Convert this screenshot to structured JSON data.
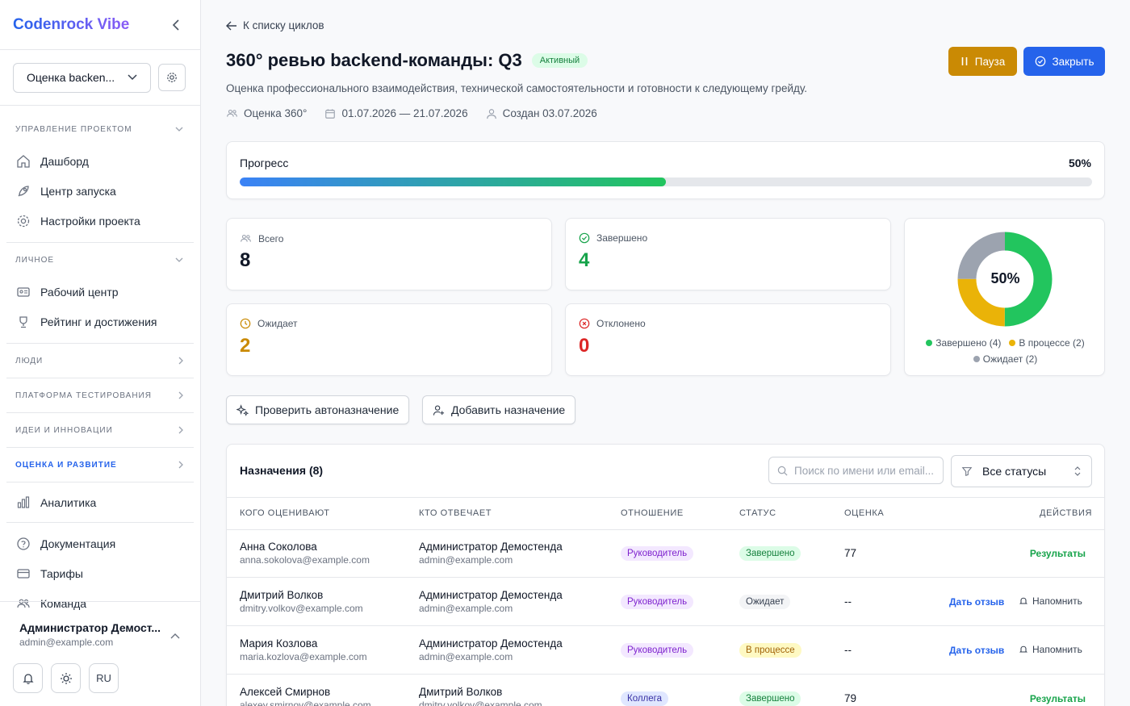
{
  "brand": "Codenrock Vibe",
  "project_select": "Оценка backen...",
  "sidebar": {
    "section_project": "Управление проектом",
    "project_items": [
      "Дашборд",
      "Центр запуска",
      "Настройки проекта"
    ],
    "section_personal": "Личное",
    "personal_items": [
      "Рабочий центр",
      "Рейтинг и достижения"
    ],
    "section_people": "Люди",
    "section_testing": "Платформа тестирования",
    "section_ideas": "Идеи и инновации",
    "section_eval": "Оценка и развитие",
    "analytics": "Аналитика",
    "bottom_items": [
      "Документация",
      "Тарифы",
      "Команда"
    ]
  },
  "user": {
    "name": "Администратор Демост...",
    "email": "admin@example.com",
    "lang": "RU"
  },
  "header": {
    "back": "К списку циклов",
    "title": "360° ревью backend-команды: Q3",
    "status": "Активный",
    "subtitle": "Оценка профессионального взаимодействия, технической самостоятельности и готовности к следующему грейду.",
    "meta_type": "Оценка 360°",
    "meta_dates": "01.07.2026 — 21.07.2026",
    "meta_created": "Создан 03.07.2026",
    "pause": "Пауза",
    "close": "Закрыть"
  },
  "progress": {
    "label": "Прогресс",
    "percent_text": "50%",
    "value": 0.5
  },
  "stats": {
    "total_label": "Всего",
    "total": "8",
    "done_label": "Завершено",
    "done": "4",
    "pending_label": "Ожидает",
    "pending": "2",
    "rejected_label": "Отклонено",
    "rejected": "0"
  },
  "donut": {
    "center": "50%",
    "legend": [
      "Завершено (4)",
      "В процессе (2)",
      "Ожидает (2)"
    ],
    "values": [
      4,
      2,
      2
    ],
    "colors": [
      "#22c55e",
      "#eab308",
      "#9ca3af"
    ]
  },
  "actions": {
    "check": "Проверить автоназначение",
    "add": "Добавить назначение"
  },
  "table": {
    "title": "Назначения (8)",
    "search_placeholder": "Поиск по имени или email...",
    "filter": "Все статусы",
    "headers": [
      "Кого оценивают",
      "Кто отвечает",
      "Отношение",
      "Статус",
      "Оценка",
      "Действия"
    ],
    "rows": [
      {
        "who": "Анна Соколова",
        "who_email": "anna.sokolova@example.com",
        "resp": "Администратор Демостенда",
        "resp_email": "admin@example.com",
        "relation": "Руководитель",
        "status": "Завершено",
        "score": "77",
        "action": "Результаты"
      },
      {
        "who": "Дмитрий Волков",
        "who_email": "dmitry.volkov@example.com",
        "resp": "Администратор Демостенда",
        "resp_email": "admin@example.com",
        "relation": "Руководитель",
        "status": "Ожидает",
        "score": "--",
        "action": "Дать отзыв",
        "remind": "Напомнить"
      },
      {
        "who": "Мария Козлова",
        "who_email": "maria.kozlova@example.com",
        "resp": "Администратор Демостенда",
        "resp_email": "admin@example.com",
        "relation": "Руководитель",
        "status": "В процессе",
        "score": "--",
        "action": "Дать отзыв",
        "remind": "Напомнить"
      },
      {
        "who": "Алексей Смирнов",
        "who_email": "alexey.smirnov@example.com",
        "resp": "Дмитрий Волков",
        "resp_email": "dmitry.volkov@example.com",
        "relation": "Коллега",
        "status": "Завершено",
        "score": "79",
        "action": "Результаты"
      }
    ]
  }
}
